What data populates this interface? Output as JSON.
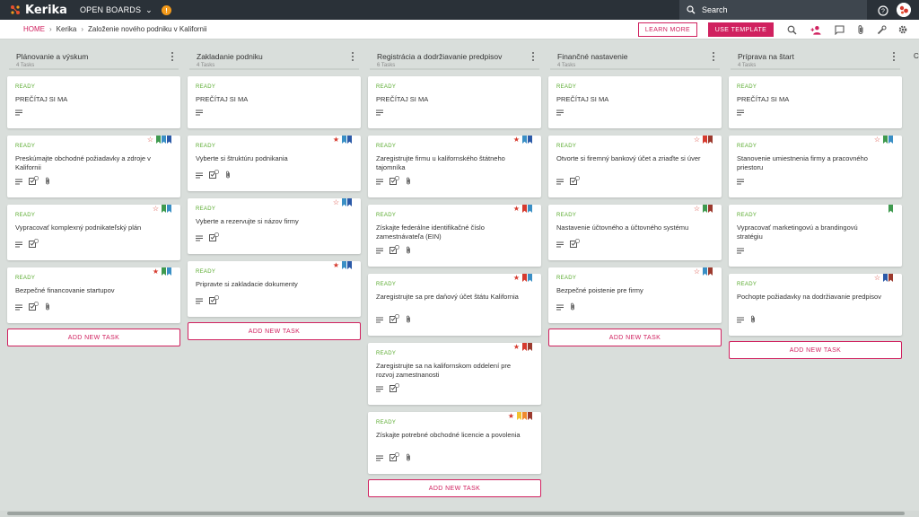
{
  "app": {
    "logo_text": "Kerika",
    "open_boards_label": "OPEN BOARDS",
    "search_placeholder": "Search"
  },
  "header": {
    "breadcrumb": [
      "HOME",
      "Kerika",
      "Založenie nového podniku v Kalifornii"
    ],
    "learn_more_label": "LEARN MORE",
    "use_template_label": "USE TEMPLATE"
  },
  "colors": {
    "accent": "#d0215f",
    "ready": "#5aab2f",
    "topbar": "#2a3138",
    "board_bg": "#d9dedb"
  },
  "add_task_label": "ADD NEW TASK",
  "columns": [
    {
      "title": "Plánovanie a výskum",
      "count": "4 Tasks",
      "cards": [
        {
          "status": "READY",
          "title": "PREČÍTAJ SI MA",
          "star": "none",
          "tags": [],
          "icons": [
            "description"
          ]
        },
        {
          "status": "READY",
          "title": "Preskúmajte obchodné požiadavky a zdroje v Kalifornii",
          "star": "outline",
          "tags": [
            "#3f9a4f",
            "#3a8fc5",
            "#2b5aa8"
          ],
          "icons": [
            "description",
            "checklist",
            "attachment"
          ]
        },
        {
          "status": "READY",
          "title": "Vypracovať komplexný podnikateľský plán",
          "star": "outline",
          "tags": [
            "#3f9a4f",
            "#3a8fc5"
          ],
          "icons": [
            "description",
            "checklist"
          ]
        },
        {
          "status": "READY",
          "title": "Bezpečné financovanie startupov",
          "star": "filled",
          "tags": [
            "#3f9a4f",
            "#3a8fc5"
          ],
          "icons": [
            "description",
            "checklist",
            "attachment"
          ]
        }
      ]
    },
    {
      "title": "Zakladanie podniku",
      "count": "4 Tasks",
      "cards": [
        {
          "status": "READY",
          "title": "PREČÍTAJ SI MA",
          "star": "none",
          "tags": [],
          "icons": [
            "description"
          ]
        },
        {
          "status": "READY",
          "title": "Vyberte si štruktúru podnikania",
          "star": "filled",
          "tags": [
            "#3a8fc5",
            "#2b5aa8"
          ],
          "icons": [
            "description",
            "checklist",
            "attachment"
          ]
        },
        {
          "status": "READY",
          "title": "Vyberte a rezervujte si názov firmy",
          "star": "outline",
          "tags": [
            "#3a8fc5",
            "#2b5aa8"
          ],
          "icons": [
            "description",
            "checklist"
          ]
        },
        {
          "status": "READY",
          "title": "Pripravte si zakladacie dokumenty",
          "star": "filled",
          "tags": [
            "#3a8fc5",
            "#2b5aa8"
          ],
          "icons": [
            "description",
            "checklist"
          ]
        }
      ]
    },
    {
      "title": "Registrácia a dodržiavanie predpisov",
      "count": "6 Tasks",
      "cards": [
        {
          "status": "READY",
          "title": "PREČÍTAJ SI MA",
          "star": "none",
          "tags": [],
          "icons": [
            "description"
          ]
        },
        {
          "status": "READY",
          "title": "Zaregistrujte firmu u kalifornského štátneho tajomníka",
          "star": "filled",
          "tags": [
            "#3a8fc5",
            "#2b5aa8"
          ],
          "icons": [
            "description",
            "checklist",
            "attachment"
          ]
        },
        {
          "status": "READY",
          "title": "Získajte federálne identifikačné číslo zamestnávateľa (EIN)",
          "star": "filled",
          "tags": [
            "#d63a2e",
            "#3a8fc5"
          ],
          "icons": [
            "description",
            "checklist",
            "attachment"
          ]
        },
        {
          "status": "READY",
          "title": "Zaregistrujte sa pre daňový účet štátu Kalifornia",
          "star": "filled",
          "tags": [
            "#d63a2e",
            "#3a8fc5"
          ],
          "icons": [
            "description",
            "checklist",
            "attachment"
          ]
        },
        {
          "status": "READY",
          "title": "Zaregistrujte sa na kalifornskom oddelení pre rozvoj zamestnanosti",
          "star": "filled",
          "tags": [
            "#d63a2e",
            "#9c3a2e"
          ],
          "icons": [
            "description",
            "checklist"
          ]
        },
        {
          "status": "READY",
          "title": "Získajte potrebné obchodné licencie a povolenia",
          "star": "filled",
          "tags": [
            "#f2c230",
            "#ef8a2e",
            "#9c3a2e"
          ],
          "icons": [
            "description",
            "checklist",
            "attachment"
          ]
        }
      ]
    },
    {
      "title": "Finančné nastavenie",
      "count": "4 Tasks",
      "cards": [
        {
          "status": "READY",
          "title": "PREČÍTAJ SI MA",
          "star": "none",
          "tags": [],
          "icons": [
            "description"
          ]
        },
        {
          "status": "READY",
          "title": "Otvorte si firemný bankový účet a zriaďte si úver",
          "star": "outline",
          "tags": [
            "#d63a2e",
            "#9c3a2e"
          ],
          "icons": [
            "description",
            "checklist"
          ]
        },
        {
          "status": "READY",
          "title": "Nastavenie účtovného a účtovného systému",
          "star": "outline",
          "tags": [
            "#3f9a4f",
            "#9c3a2e"
          ],
          "icons": [
            "description",
            "checklist"
          ]
        },
        {
          "status": "READY",
          "title": "Bezpečné poistenie pre firmy",
          "star": "outline",
          "tags": [
            "#3a8fc5",
            "#9c3a2e"
          ],
          "icons": [
            "description",
            "attachment"
          ]
        }
      ]
    },
    {
      "title": "Príprava na štart",
      "count": "4 Tasks",
      "cards": [
        {
          "status": "READY",
          "title": "PREČÍTAJ SI MA",
          "star": "none",
          "tags": [],
          "icons": [
            "description"
          ]
        },
        {
          "status": "READY",
          "title": "Stanovenie umiestnenia firmy a pracovného priestoru",
          "star": "outline",
          "tags": [
            "#3f9a4f",
            "#3a8fc5"
          ],
          "icons": [
            "description"
          ]
        },
        {
          "status": "READY",
          "title": "Vypracovať marketingovú a brandingovú stratégiu",
          "star": "none",
          "tags": [
            "#3f9a4f"
          ],
          "icons": [
            "description"
          ]
        },
        {
          "status": "READY",
          "title": "Pochopte požiadavky na dodržiavanie predpisov",
          "star": "outline",
          "tags": [
            "#2b5aa8",
            "#9c3a2e"
          ],
          "icons": [
            "description",
            "attachment"
          ]
        }
      ]
    }
  ],
  "partial_column_initial": "C"
}
